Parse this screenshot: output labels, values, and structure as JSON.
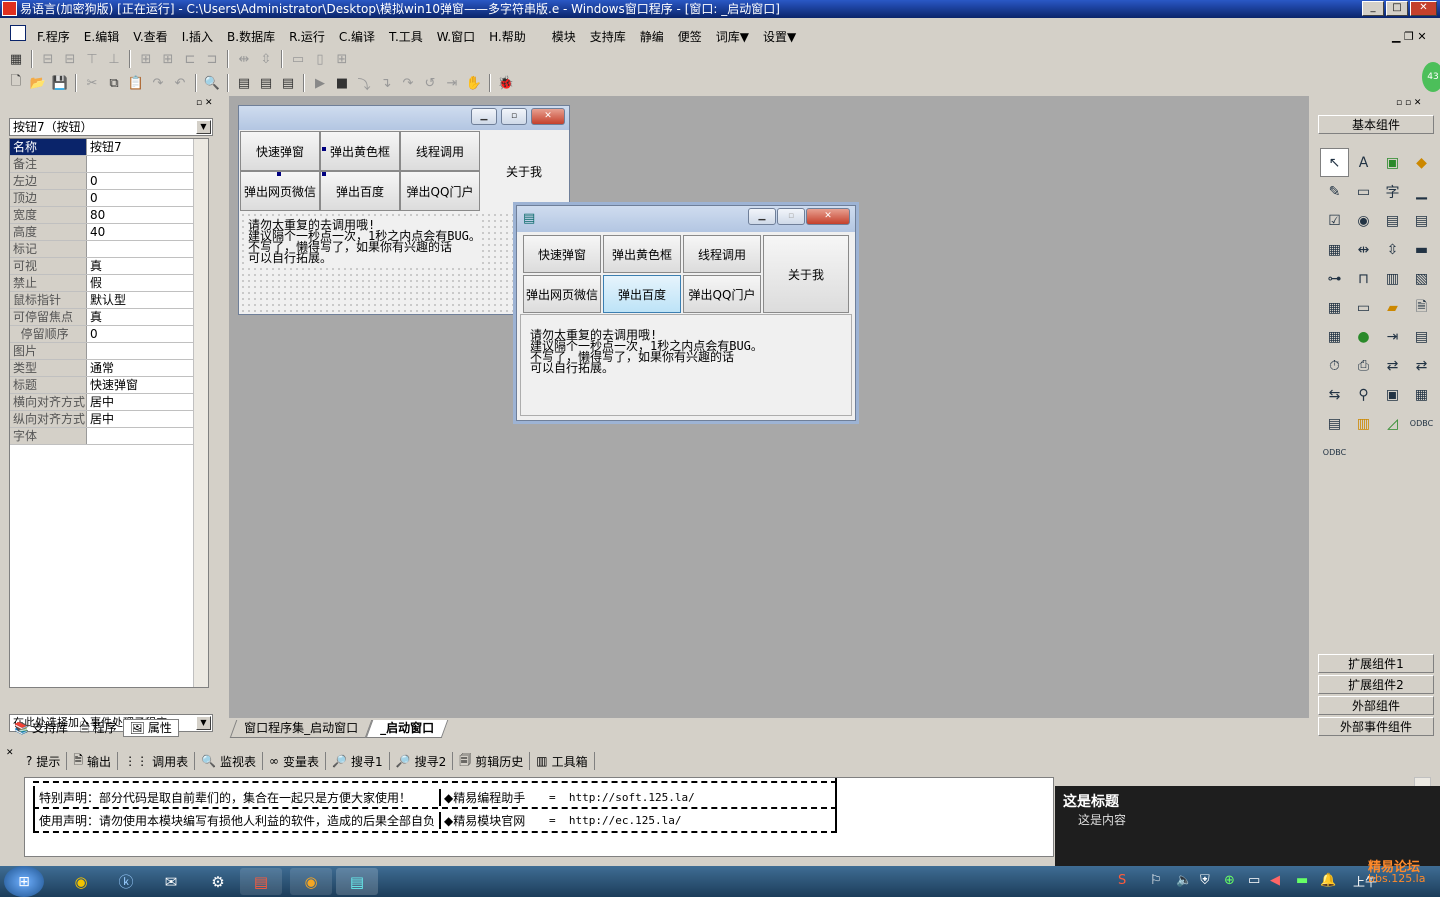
{
  "titlebar": {
    "title": "易语言(加密狗版) [正在运行] - C:\\Users\\Administrator\\Desktop\\模拟win10弹窗——多字符串版.e - Windows窗口程序 - [窗口: _启动窗口]",
    "min": "_",
    "max": "□",
    "close": "✕"
  },
  "menu": [
    "F.程序",
    "E.编辑",
    "V.查看",
    "I.插入",
    "B.数据库",
    "R.运行",
    "C.编译",
    "T.工具",
    "W.窗口",
    "H.帮助",
    "模块",
    "支持库",
    "静编",
    "便签",
    "词库▼",
    "设置▼"
  ],
  "left": {
    "combo": "按钮7（按钮）",
    "props": [
      {
        "n": "名称",
        "v": "按钮7"
      },
      {
        "n": "备注",
        "v": ""
      },
      {
        "n": "左边",
        "v": "0"
      },
      {
        "n": "顶边",
        "v": "0"
      },
      {
        "n": "宽度",
        "v": "80"
      },
      {
        "n": "高度",
        "v": "40"
      },
      {
        "n": "标记",
        "v": ""
      },
      {
        "n": "可视",
        "v": "真"
      },
      {
        "n": "禁止",
        "v": "假"
      },
      {
        "n": "鼠标指针",
        "v": "默认型"
      },
      {
        "n": "可停留焦点",
        "v": "真"
      },
      {
        "n": "  停留顺序",
        "v": "0"
      },
      {
        "n": "图片",
        "v": ""
      },
      {
        "n": "类型",
        "v": "通常"
      },
      {
        "n": "标题",
        "v": "快速弹窗"
      },
      {
        "n": "横向对齐方式",
        "v": "居中"
      },
      {
        "n": "纵向对齐方式",
        "v": "居中"
      },
      {
        "n": "字体",
        "v": ""
      }
    ],
    "event_combo": "在此处选择加入事件处理子程序",
    "tabs": [
      "支持库",
      "程序",
      "属性"
    ]
  },
  "form": {
    "buttons": [
      "快速弹窗",
      "弹出黄色框",
      "线程调用",
      "关于我",
      "弹出网页微信",
      "弹出百度",
      "弹出QQ门户"
    ],
    "content": "请勿太重复的去调用哦!\n建议隔个一秒点一次，1秒之内点会有BUG。\n不写了，懒得写了，如果你有兴趣的话\n可以自行拓展。"
  },
  "design_tabs": [
    "窗口程序集_启动窗口",
    "_启动窗口"
  ],
  "right": {
    "header": "基本组件",
    "groups": [
      "扩展组件1",
      "扩展组件2",
      "外部组件",
      "外部事件组件"
    ]
  },
  "bottom": {
    "tabs": [
      "提示",
      "输出",
      "调用表",
      "监视表",
      "变量表",
      "搜寻1",
      "搜寻2",
      "剪辑历史",
      "工具箱"
    ],
    "rows": [
      {
        "a": "特别声明：部分代码是取自前辈们的，集合在一起只是方便大家使用！",
        "b": "◆精易编程助手",
        "c": "http://soft.125.la/"
      },
      {
        "a": "使用声明：请勿使用本模块编写有损他人利益的软件，造成的后果全部自负",
        "b": "◆精易模块官网",
        "c": "http://ec.125.la/"
      }
    ]
  },
  "toast": {
    "title": "这是标题",
    "body": "这是内容"
  },
  "taskbar": {
    "clock": "上午",
    "watermark": "精易论坛",
    "watermark_sub": "bbs.125.la",
    "badge": "43"
  }
}
